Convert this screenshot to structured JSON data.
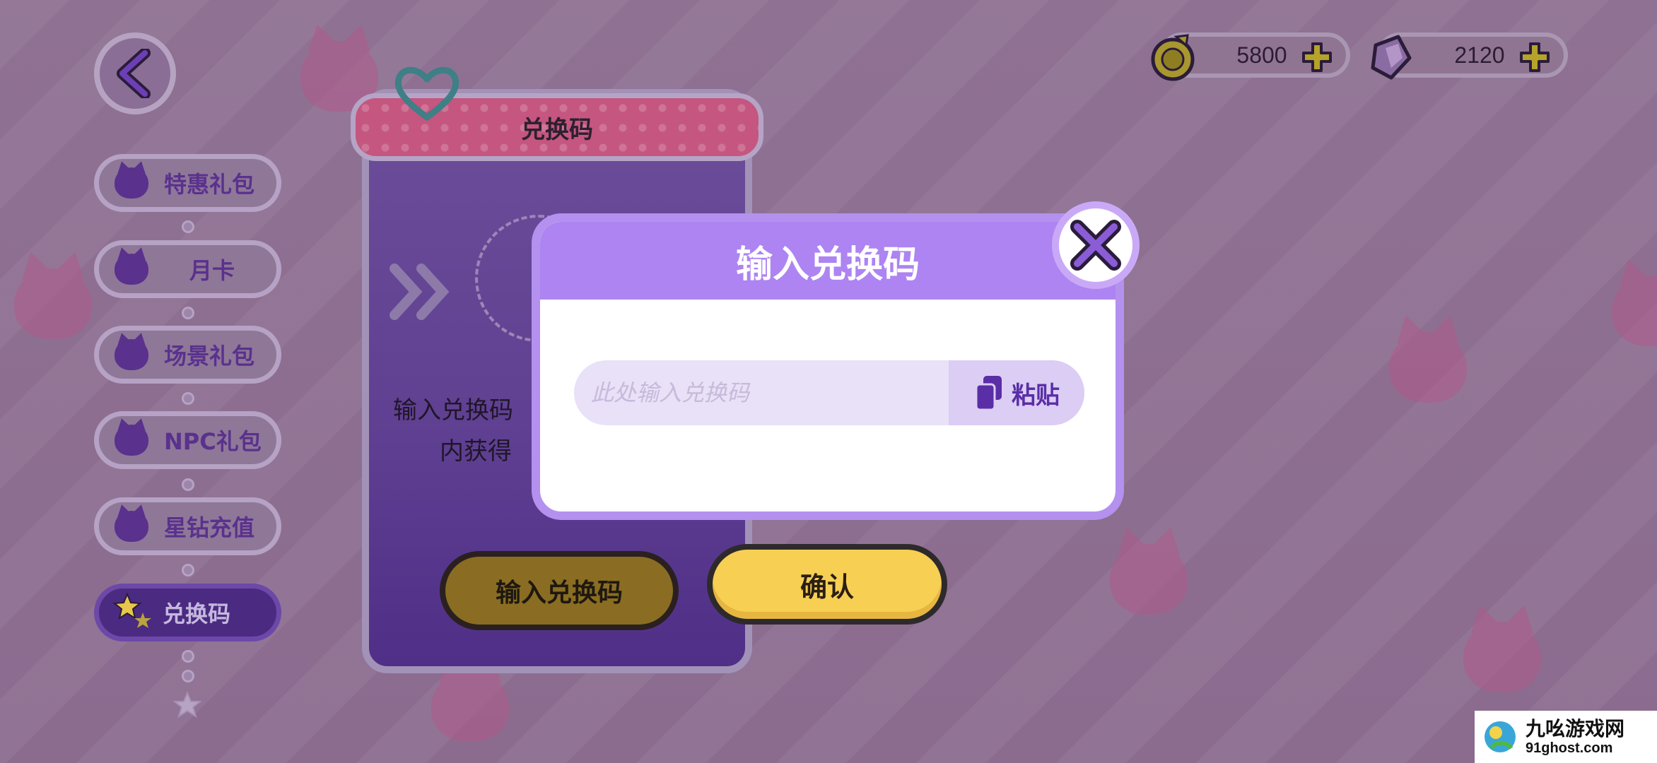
{
  "header": {
    "gold_amount": "5800",
    "gem_amount": "2120"
  },
  "sidebar": {
    "items": [
      {
        "label": "特惠礼包",
        "icon": "cat-icon"
      },
      {
        "label": "月卡",
        "icon": "cat-icon"
      },
      {
        "label": "场景礼包",
        "icon": "cat-icon"
      },
      {
        "label": "NPC礼包",
        "icon": "cat-icon"
      },
      {
        "label": "星钻充值",
        "icon": "cat-icon"
      },
      {
        "label": "兑换码",
        "icon": "star-icon",
        "active": true
      }
    ]
  },
  "card": {
    "title": "兑换码",
    "text_line1": "输入兑换码",
    "text_line2": "内获得",
    "button_label": "输入兑换码"
  },
  "confirm_label": "确认",
  "modal": {
    "title": "输入兑换码",
    "placeholder": "此处输入兑换码",
    "value": "",
    "paste_label": "粘贴"
  },
  "watermark": {
    "title": "九吆游戏网",
    "url": "91ghost.com"
  },
  "colors": {
    "modal_header": "#ad84f2",
    "confirm": "#f7cf53",
    "accent": "#5a2ea6"
  }
}
